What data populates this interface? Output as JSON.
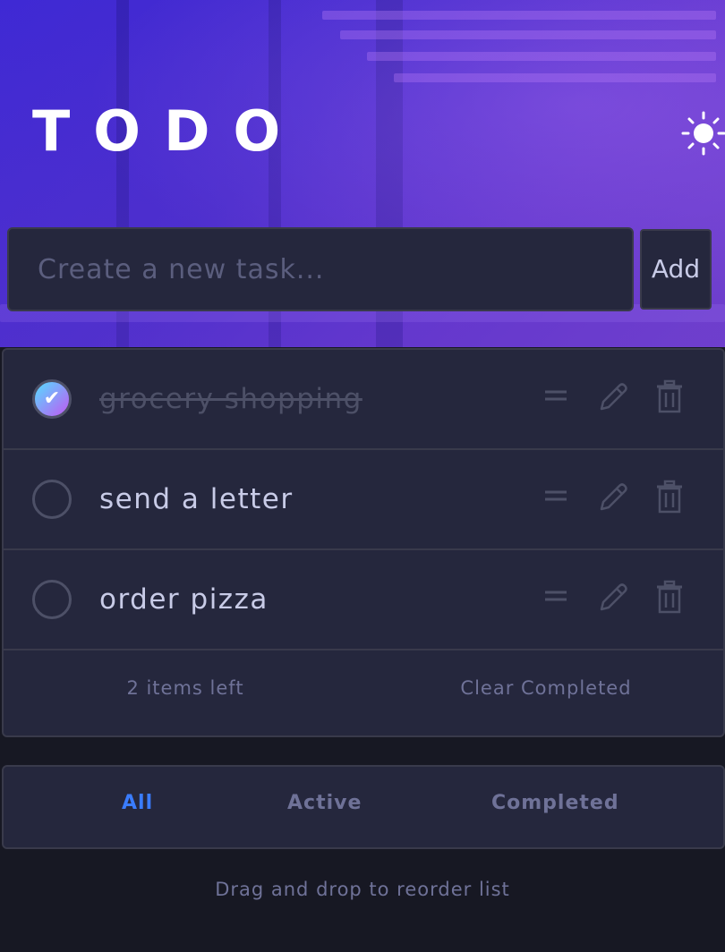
{
  "app": {
    "title": "TODO",
    "theme_toggle_icon": "sun-icon"
  },
  "new_task": {
    "placeholder": "Create a new task...",
    "value": "",
    "add_label": "Add"
  },
  "tasks": [
    {
      "label": "grocery shopping",
      "completed": true
    },
    {
      "label": "send a letter",
      "completed": false
    },
    {
      "label": "order pizza",
      "completed": false
    }
  ],
  "task_actions": {
    "drag_icon": "drag-handle-icon",
    "edit_icon": "pencil-icon",
    "delete_icon": "trash-icon"
  },
  "list_footer": {
    "items_left": "2 items left",
    "clear_completed": "Clear Completed"
  },
  "filters": {
    "all": "All",
    "active": "Active",
    "completed": "Completed",
    "selected": "All"
  },
  "hint": "Drag and drop to reorder list",
  "colors": {
    "background": "#171823",
    "card": "#25273d",
    "border": "#393a4b",
    "text": "#c8cbe7",
    "muted": "#6f7298",
    "accent": "#3a7cfd",
    "check_gradient_start": "#55ddff",
    "check_gradient_end": "#c058f3"
  }
}
